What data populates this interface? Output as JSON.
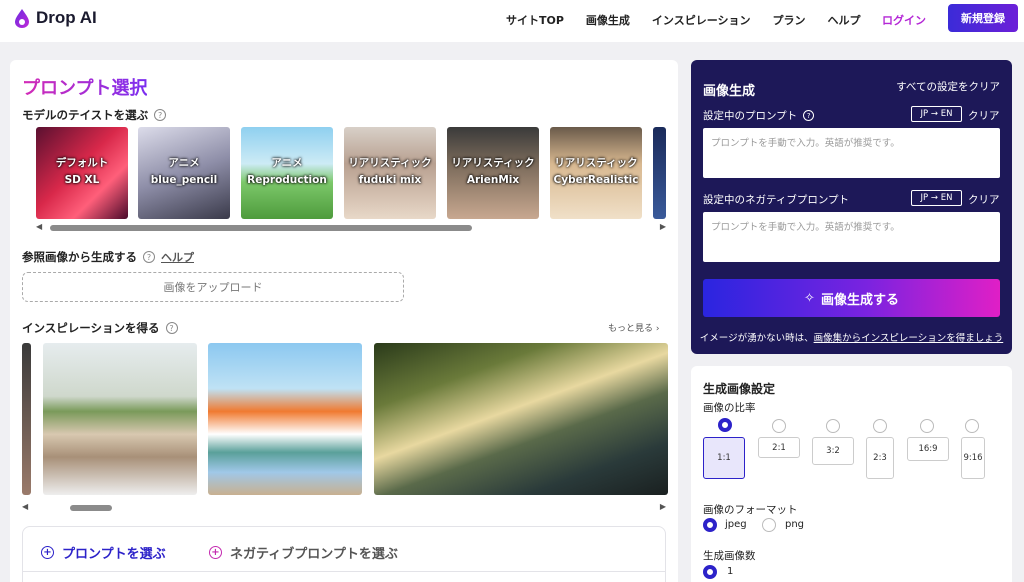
{
  "header": {
    "logo": "Drop AI",
    "nav": [
      "サイトTOP",
      "画像生成",
      "インスピレーション",
      "プラン",
      "ヘルプ"
    ],
    "login": "ログイン",
    "signup": "新規登録"
  },
  "left": {
    "title": "プロンプト選択",
    "model_section": "モデルのテイストを選ぶ",
    "models": [
      {
        "line1": "デフォルト",
        "line2": "SD XL"
      },
      {
        "line1": "アニメ",
        "line2": "blue_pencil"
      },
      {
        "line1": "アニメ",
        "line2": "Reproduction"
      },
      {
        "line1": "リアリスティック",
        "line2": "fuduki mix"
      },
      {
        "line1": "リアリスティック",
        "line2": "ArienMix"
      },
      {
        "line1": "リアリスティック",
        "line2": "CyberRealistic"
      }
    ],
    "ref_section": "参照画像から生成する",
    "help": "ヘルプ",
    "upload": "画像をアップロード",
    "insp_section": "インスピレーションを得る",
    "more": "もっと見る",
    "tabs": [
      "プロンプトを選ぶ",
      "ネガティブプロンプトを選ぶ"
    ]
  },
  "gen": {
    "title": "画像生成",
    "reset_all": "すべての設定をクリア",
    "prompt_label": "設定中のプロンプト",
    "neg_label": "設定中のネガティブプロンプト",
    "jp_en": "JP → EN",
    "clear": "クリア",
    "placeholder": "プロンプトを手動で入力。英語が推奨です。",
    "button": "画像生成する",
    "hint_prefix": "イメージが湧かない時は、",
    "hint_link": "画像集からインスピレーションを得ましょう"
  },
  "settings": {
    "title": "生成画像設定",
    "ratio_label": "画像の比率",
    "ratios": [
      "1:1",
      "2:1",
      "3:2",
      "2:3",
      "16:9",
      "9:16"
    ],
    "selected_ratio": "1:1",
    "format_label": "画像のフォーマット",
    "formats": [
      "jpeg",
      "png"
    ],
    "selected_format": "jpeg",
    "count_label": "生成画像数",
    "count": "1"
  },
  "colors": {
    "accent": "#2c22c9",
    "panel": "#1d1858",
    "title_gradient_start": "#d42bb6",
    "title_gradient_end": "#7b2ef0"
  }
}
